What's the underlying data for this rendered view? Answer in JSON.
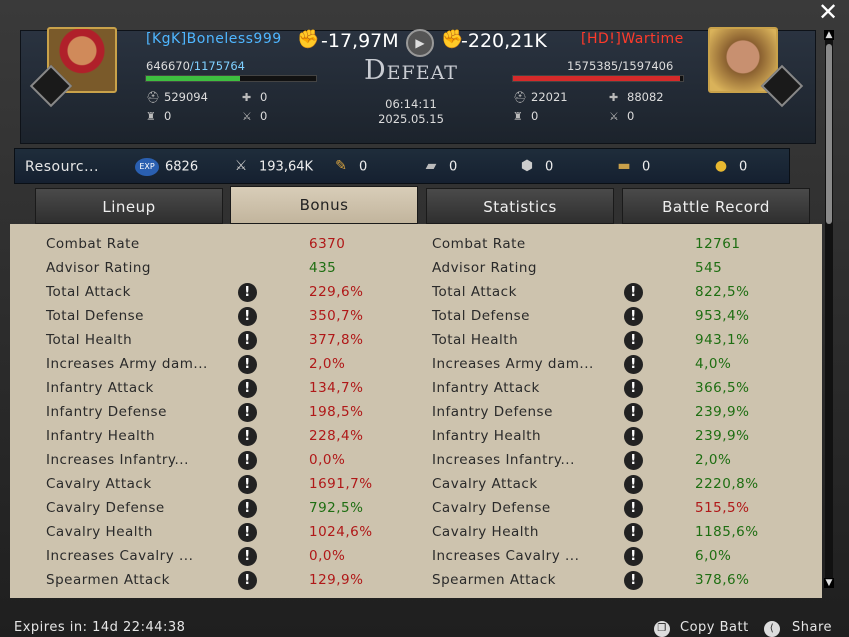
{
  "close_icon": "close-icon",
  "header": {
    "left": {
      "name": "[KgK]Boneless999",
      "troops_current": "646670",
      "troops_max": "/1175764",
      "hp_fraction": 0.55,
      "loss": "-17,97M",
      "stat_a": "529094",
      "stat_b": "0",
      "stat_c": "0",
      "stat_d": "0"
    },
    "right": {
      "name": "[HD!]Wartime",
      "troops_current": "1575385",
      "troops_max": "/1597406",
      "hp_fraction": 0.985,
      "loss": "-220,21K",
      "stat_a": "22021",
      "stat_b": "88082",
      "stat_c": "0",
      "stat_d": "0"
    },
    "result": "Defeat",
    "time": "06:14:11",
    "date": "2025.05.15"
  },
  "resources": {
    "label": "Resourc...",
    "items": [
      {
        "icon": "exp-icon",
        "value": "6826"
      },
      {
        "icon": "kills-icon",
        "value": "193,64K"
      },
      {
        "icon": "food-icon",
        "value": "0"
      },
      {
        "icon": "iron-icon",
        "value": "0"
      },
      {
        "icon": "stone-icon",
        "value": "0"
      },
      {
        "icon": "wood-icon",
        "value": "0"
      },
      {
        "icon": "gold-icon",
        "value": "0"
      }
    ]
  },
  "tabs": [
    "Lineup",
    "Bonus",
    "Statistics",
    "Battle Record"
  ],
  "active_tab": "Bonus",
  "rows": [
    {
      "label": "Combat Rate",
      "left": "6370",
      "right": "12761",
      "info": false,
      "lc": "red",
      "rc": "green"
    },
    {
      "label": "Advisor Rating",
      "left": "435",
      "right": "545",
      "info": false,
      "lc": "green",
      "rc": "green"
    },
    {
      "label": "Total Attack",
      "left": "229,6%",
      "right": "822,5%",
      "info": true,
      "lc": "red",
      "rc": "green"
    },
    {
      "label": "Total Defense",
      "left": "350,7%",
      "right": "953,4%",
      "info": true,
      "lc": "red",
      "rc": "green"
    },
    {
      "label": "Total Health",
      "left": "377,8%",
      "right": "943,1%",
      "info": true,
      "lc": "red",
      "rc": "green"
    },
    {
      "label": "Increases Army dam...",
      "left": "2,0%",
      "right": "4,0%",
      "info": true,
      "lc": "red",
      "rc": "green"
    },
    {
      "label": "Infantry Attack",
      "left": "134,7%",
      "right": "366,5%",
      "info": true,
      "lc": "red",
      "rc": "green"
    },
    {
      "label": "Infantry Defense",
      "left": "198,5%",
      "right": "239,9%",
      "info": true,
      "lc": "red",
      "rc": "green"
    },
    {
      "label": "Infantry Health",
      "left": "228,4%",
      "right": "239,9%",
      "info": true,
      "lc": "red",
      "rc": "green"
    },
    {
      "label": "Increases Infantry...",
      "left": "0,0%",
      "right": "2,0%",
      "info": true,
      "lc": "red",
      "rc": "green"
    },
    {
      "label": "Cavalry Attack",
      "left": "1691,7%",
      "right": "2220,8%",
      "info": true,
      "lc": "red",
      "rc": "green"
    },
    {
      "label": "Cavalry Defense",
      "left": "792,5%",
      "right": "515,5%",
      "info": true,
      "lc": "green",
      "rc": "red"
    },
    {
      "label": "Cavalry Health",
      "left": "1024,6%",
      "right": "1185,6%",
      "info": true,
      "lc": "red",
      "rc": "green"
    },
    {
      "label": "Increases Cavalry ...",
      "left": "0,0%",
      "right": "6,0%",
      "info": true,
      "lc": "red",
      "rc": "green"
    },
    {
      "label": "Spearmen Attack",
      "left": "129,9%",
      "right": "378,6%",
      "info": true,
      "lc": "red",
      "rc": "green"
    }
  ],
  "footer": {
    "expires": "Expires in: 14d 22:44:38",
    "copy": "Copy Batt",
    "share": "Share"
  },
  "colors": {
    "red": "#b01818",
    "green": "#1e6e12",
    "blue_name": "#4fb6ff",
    "red_name": "#ff3a2a"
  }
}
